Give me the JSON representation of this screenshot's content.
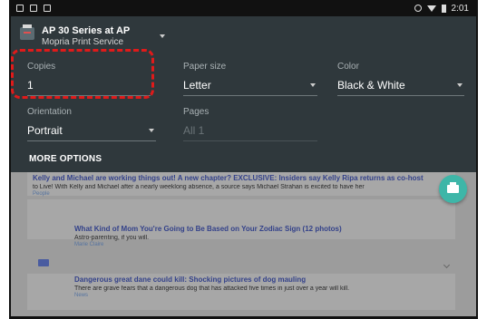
{
  "status_bar": {
    "time": "2:01"
  },
  "printer": {
    "name": "AP 30 Series at AP",
    "service": "Mopria Print Service"
  },
  "fields": {
    "copies": {
      "label": "Copies",
      "value": "1"
    },
    "paper_size": {
      "label": "Paper size",
      "value": "Letter"
    },
    "color": {
      "label": "Color",
      "value": "Black & White"
    },
    "orientation": {
      "label": "Orientation",
      "value": "Portrait"
    },
    "pages": {
      "label": "Pages",
      "value": "All 1"
    }
  },
  "more_options": "MORE OPTIONS",
  "articles": [
    {
      "title": "Kelly and Michael are working things out! A new chapter? EXCLUSIVE: Insiders say Kelly Ripa returns as co-host",
      "body": "to Live! With Kelly and Michael after a nearly weeklong absence, a source says Michael Strahan is excited to have her",
      "source": "People"
    },
    {
      "title": "What Kind of Mom You're Going to Be Based on Your Zodiac Sign (12 photos)",
      "body": "Astro-parenting, if you will.",
      "source": "Marie Claire"
    },
    {
      "title": "Dangerous great dane could kill: Shocking pictures of dog mauling",
      "body": "There are grave fears that a dangerous dog that has attacked five times in just over a year will kill.",
      "source": "News"
    }
  ],
  "colors": {
    "panel": "#2f383c",
    "fab": "#3eb6a8",
    "highlight": "#e01a1a"
  },
  "icons": {
    "fab": "print-icon",
    "printer": "printer-icon"
  }
}
